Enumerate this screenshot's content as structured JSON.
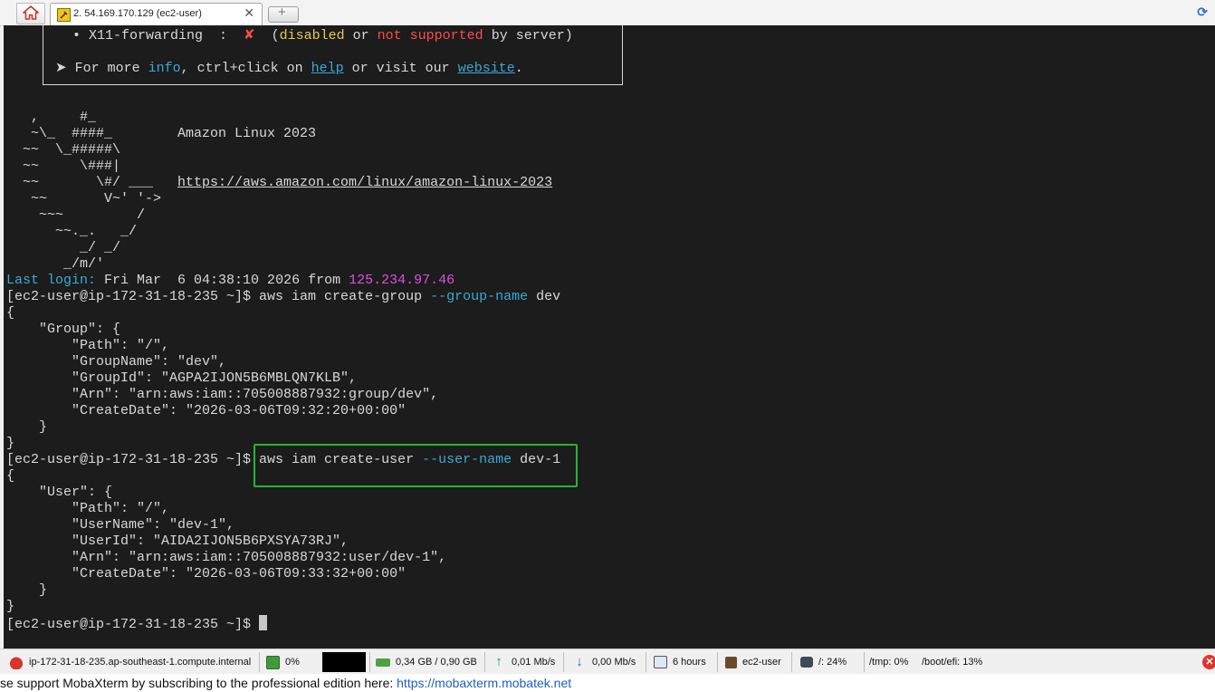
{
  "tabbar": {
    "tab_title": "2. 54.169.170.129 (ec2-user)",
    "close_glyph": "✕",
    "new_tab_glyph": "+"
  },
  "terminal": {
    "box": {
      "x11_prefix": "• X11-forwarding  :  ",
      "x11_mark": "✘",
      "x11_paren_open": "  (",
      "x11_disabled": "disabled",
      "x11_or": " or ",
      "x11_not_supported": "not supported",
      "x11_suffix": " by server)",
      "more_prefix": "➤ For more ",
      "more_info": "info",
      "more_mid": ", ctrl+click on ",
      "more_help": "help",
      "more_mid2": " or visit our ",
      "more_website": "website",
      "more_end": "."
    },
    "logo_lines": [
      "   ,     #_",
      "   ~\\_  ####_        Amazon Linux 2023",
      "  ~~  \\_#####\\",
      "  ~~     \\###|",
      "  ~~       \\#/ ___   ",
      "   ~~       V~' '->",
      "    ~~~         /",
      "      ~~._.   _/",
      "         _/ _/",
      "       _/m/'"
    ],
    "logo_url": "https://aws.amazon.com/linux/amazon-linux-2023",
    "last_login_label": "Last login:",
    "last_login_date": " Fri Mar  6 04:38:10 2026 from ",
    "last_login_ip": "125.234.97.46",
    "prompt": "[ec2-user@ip-172-31-18-235 ~]$ ",
    "cmd1_main": "aws iam create-group ",
    "cmd1_flag": "--group-name",
    "cmd1_arg": " dev",
    "group_output": [
      "{",
      "    \"Group\": {",
      "        \"Path\": \"/\",",
      "        \"GroupName\": \"dev\",",
      "        \"GroupId\": \"AGPA2IJON5B6MBLQN7KLB\",",
      "        \"Arn\": \"arn:aws:iam::705008887932:group/dev\",",
      "        \"CreateDate\": \"2026-03-06T09:32:20+00:00\"",
      "    }",
      "}"
    ],
    "cmd2_main": "aws iam create-user ",
    "cmd2_flag": "--user-name",
    "cmd2_arg": " dev-1",
    "user_output": [
      "{",
      "    \"User\": {",
      "        \"Path\": \"/\",",
      "        \"UserName\": \"dev-1\",",
      "        \"UserId\": \"AIDA2IJON5B6PXSYA73RJ\",",
      "        \"Arn\": \"arn:aws:iam::705008887932:user/dev-1\",",
      "        \"CreateDate\": \"2026-03-06T09:33:32+00:00\"",
      "    }",
      "}"
    ]
  },
  "statusbar": {
    "host": "ip-172-31-18-235.ap-southeast-1.compute.internal",
    "cpu": "0%",
    "memory": "0,34 GB / 0,90 GB",
    "upload": "0,01 Mb/s",
    "download": "0,00 Mb/s",
    "uptime": "6 hours",
    "user": "ec2-user",
    "disk_root": "/: 24%",
    "disk_tmp": "/tmp: 0%",
    "disk_boot": "/boot/efi: 13%"
  },
  "footer": {
    "text": "se support MobaXterm by subscribing to the professional edition here:  ",
    "link": "https://mobaxterm.mobatek.net"
  },
  "colors": {
    "terminal_bg": "#1c1c1c",
    "terminal_fg": "#d8d8d8",
    "cyan": "#3aa9d6",
    "magenta": "#e04fe0",
    "highlight_box": "#27b33e"
  }
}
